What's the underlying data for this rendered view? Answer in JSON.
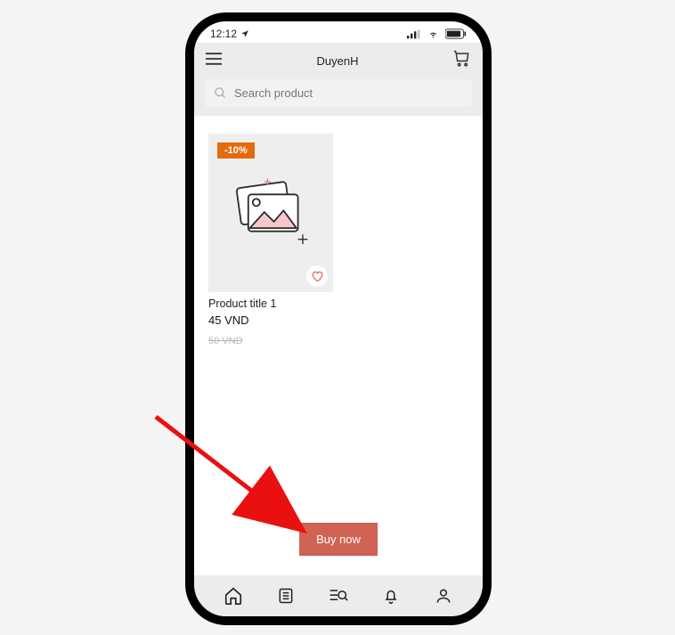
{
  "status_bar": {
    "time": "12:12"
  },
  "header": {
    "title": "DuyenH"
  },
  "search": {
    "placeholder": "Search product"
  },
  "product": {
    "discount_label": "-10%",
    "title": "Product title 1",
    "price": "45 VND",
    "old_price": "50 VND"
  },
  "actions": {
    "buy_now_label": "Buy now"
  },
  "annotation": {
    "arrow_target": "buy-now-button"
  }
}
